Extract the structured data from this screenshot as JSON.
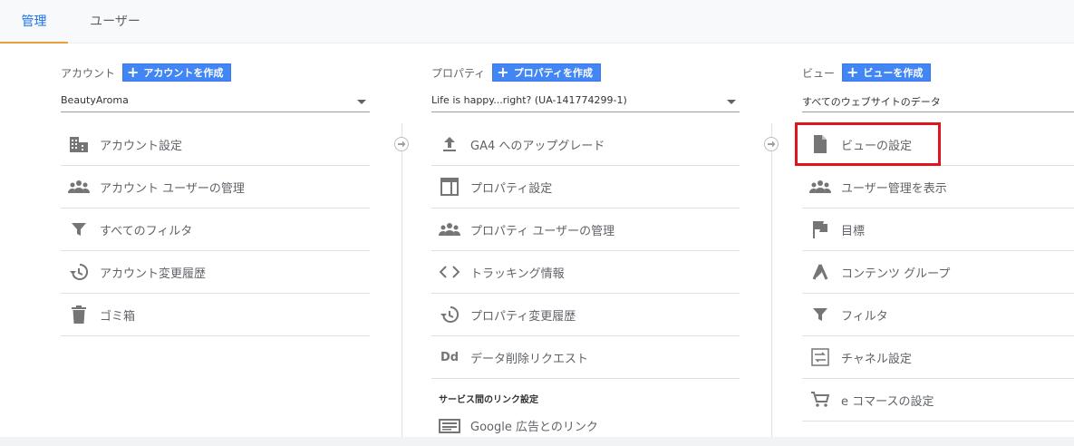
{
  "tabs": [
    {
      "label": "管理"
    },
    {
      "label": "ユーザー"
    }
  ],
  "account": {
    "title": "アカウント",
    "create_label": "アカウントを作成",
    "selected": "BeautyAroma",
    "items": [
      {
        "label": "アカウント設定",
        "icon": "building-icon"
      },
      {
        "label": "アカウント ユーザーの管理",
        "icon": "people-icon"
      },
      {
        "label": "すべてのフィルタ",
        "icon": "filter-icon"
      },
      {
        "label": "アカウント変更履歴",
        "icon": "history-icon"
      },
      {
        "label": "ゴミ箱",
        "icon": "trash-icon"
      }
    ]
  },
  "property": {
    "title": "プロパティ",
    "create_label": "プロパティを作成",
    "selected": "Life is happy...right? (UA-141774299-1)",
    "items": [
      {
        "label": "GA4 へのアップグレード",
        "icon": "upload-icon"
      },
      {
        "label": "プロパティ設定",
        "icon": "layout-icon"
      },
      {
        "label": "プロパティ ユーザーの管理",
        "icon": "people-icon"
      },
      {
        "label": "トラッキング情報",
        "icon": "code-icon"
      },
      {
        "label": "プロパティ変更履歴",
        "icon": "history-icon"
      },
      {
        "label": "データ削除リクエスト",
        "icon": "dd-icon",
        "glyph": "Dd"
      }
    ],
    "section_title": "サービス間のリンク設定",
    "links": [
      {
        "label": "Google 広告とのリンク",
        "icon": "ads-link-icon"
      }
    ]
  },
  "view": {
    "title": "ビュー",
    "create_label": "ビューを作成",
    "selected": "すべてのウェブサイトのデータ",
    "items": [
      {
        "label": "ビューの設定",
        "icon": "document-icon"
      },
      {
        "label": "ユーザー管理を表示",
        "icon": "people-icon"
      },
      {
        "label": "目標",
        "icon": "flag-icon"
      },
      {
        "label": "コンテンツ グループ",
        "icon": "content-group-icon"
      },
      {
        "label": "フィルタ",
        "icon": "filter-icon"
      },
      {
        "label": "チャネル設定",
        "icon": "channel-icon"
      },
      {
        "label": "e コマースの設定",
        "icon": "cart-icon"
      }
    ]
  },
  "colors": {
    "accent": "#1a73e8",
    "button": "#4285f4",
    "tab_underline": "#e8a13a",
    "highlight": "#e0141e",
    "icon": "#757575"
  }
}
